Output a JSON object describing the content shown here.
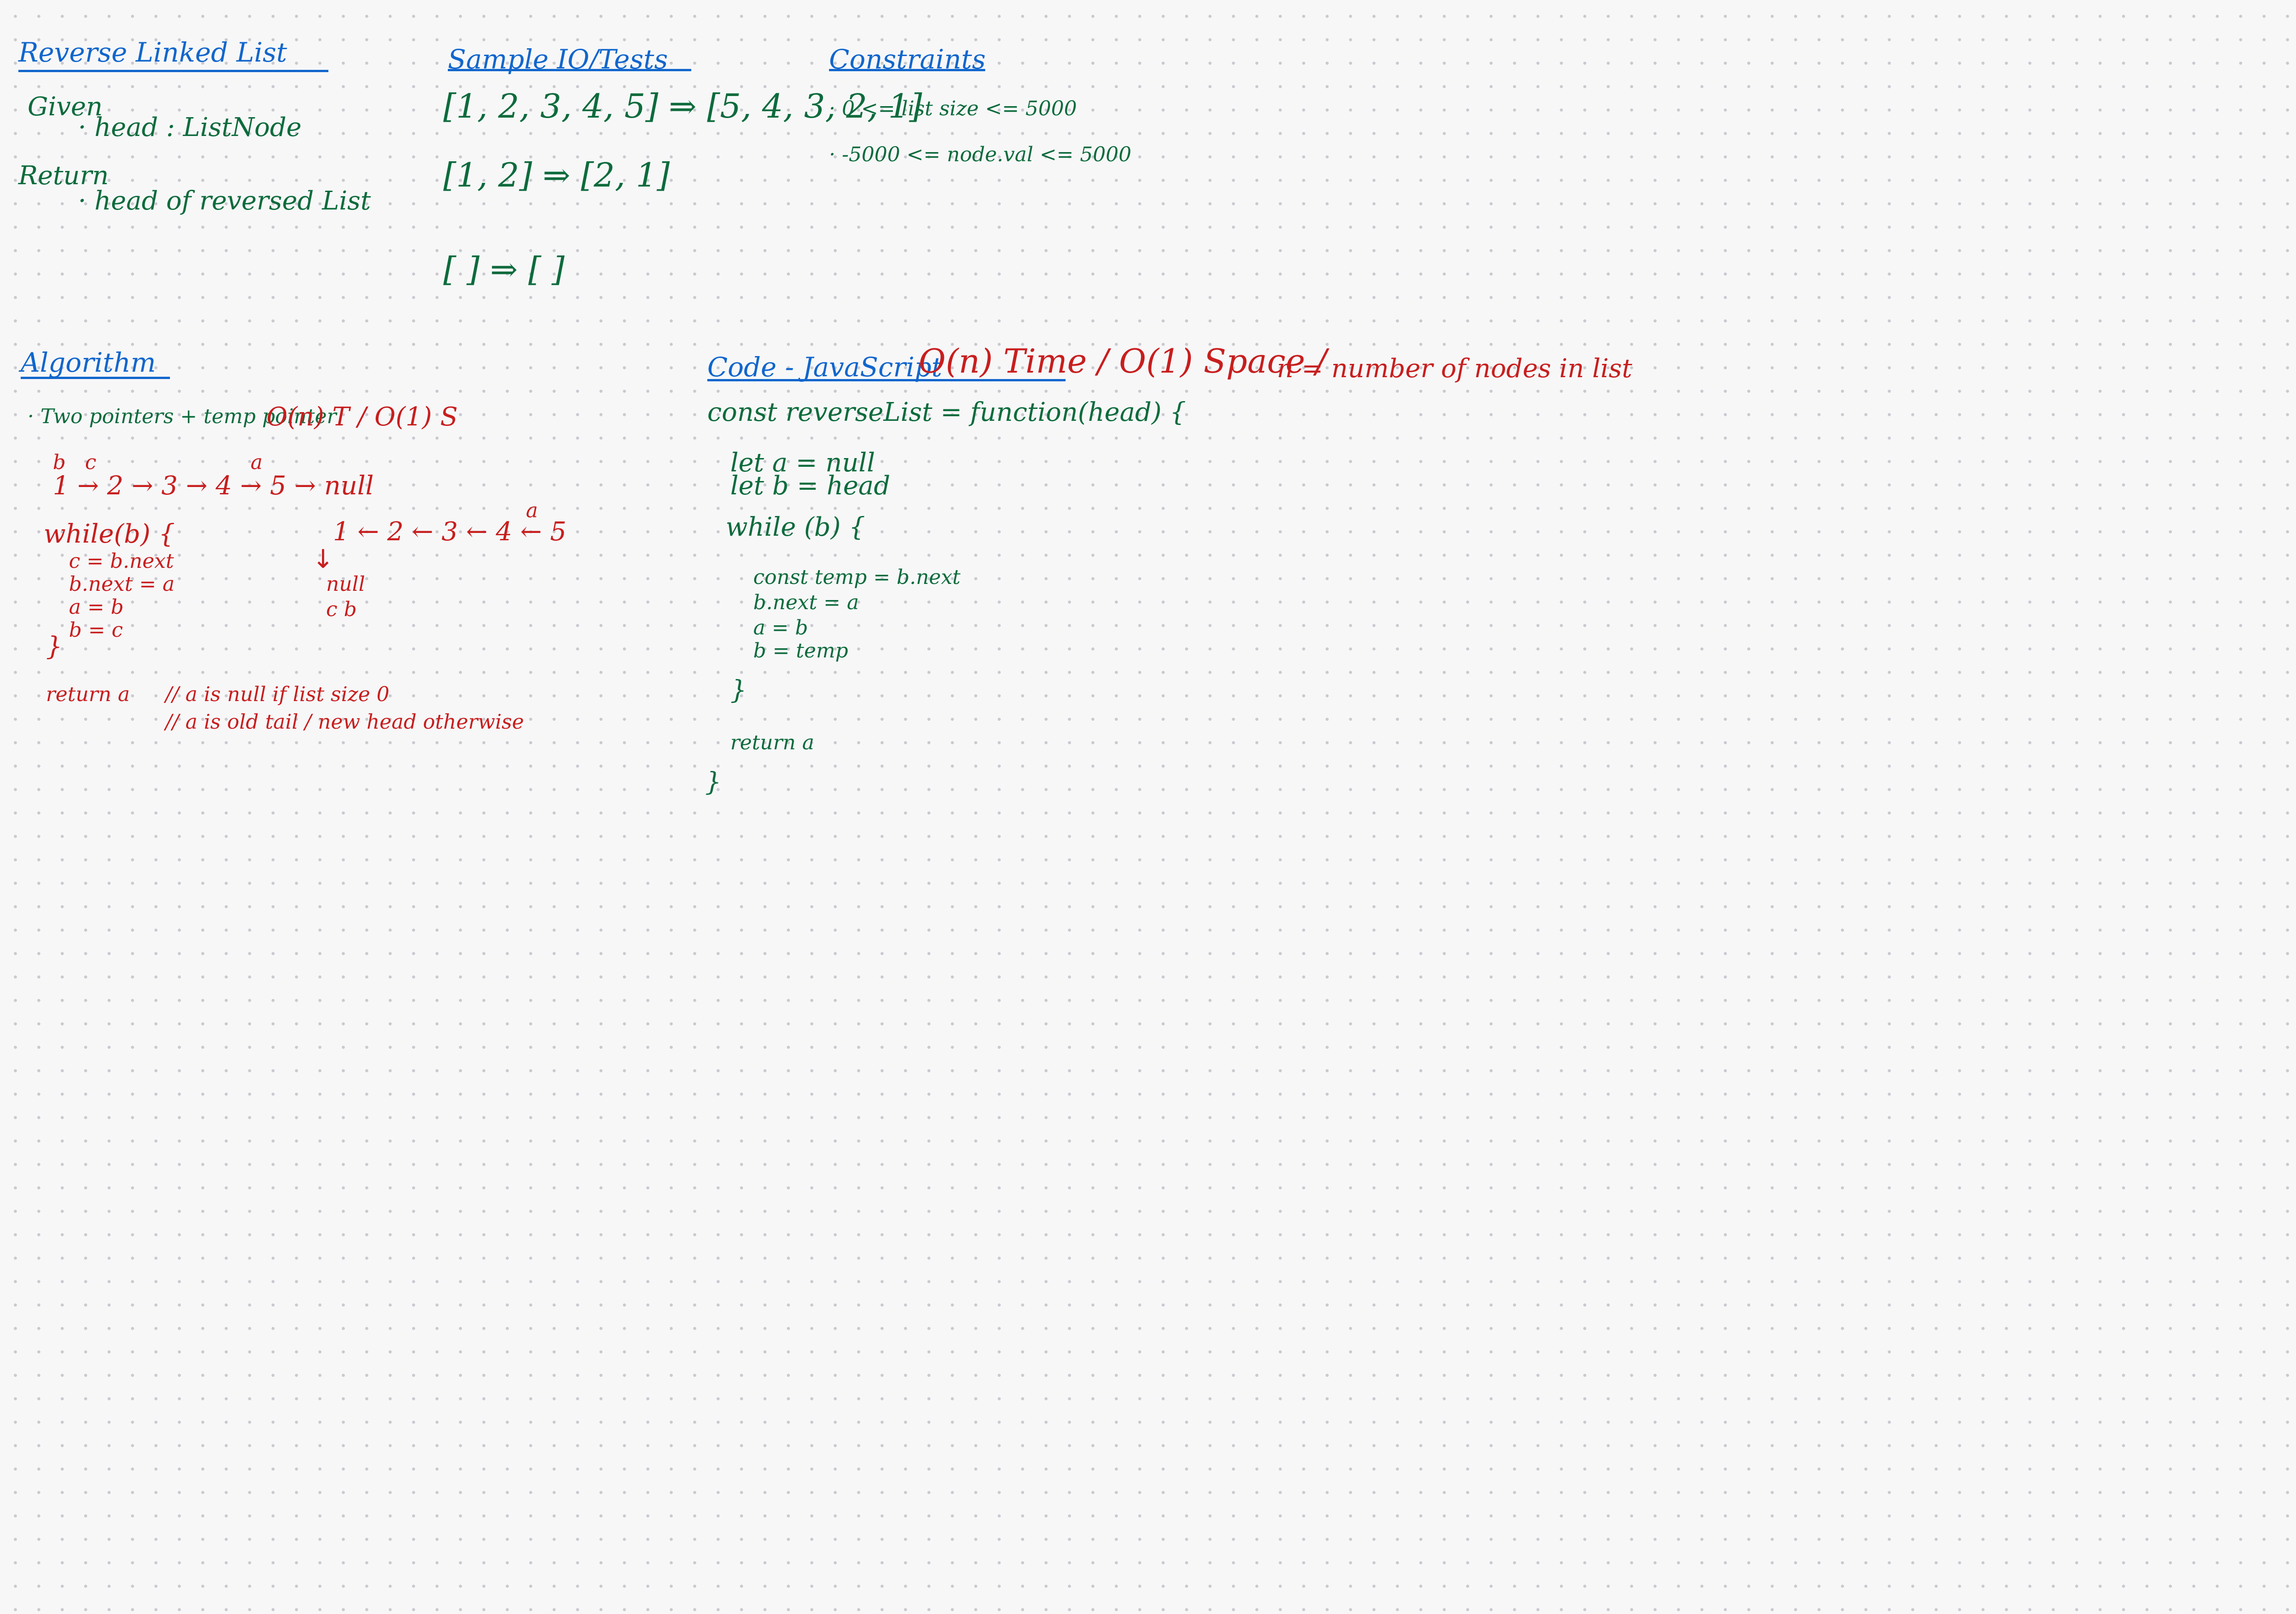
{
  "problem": {
    "title": "Reverse Linked List",
    "given_label": "Given",
    "given_item": "· head : ListNode",
    "return_label": "Return",
    "return_item": "· head of reversed List"
  },
  "samples": {
    "title": "Sample IO/Tests",
    "tests": [
      "[1, 2, 3, 4, 5] ⇒ [5, 4, 3, 2, 1]",
      "[1, 2] ⇒ [2, 1]",
      "[ ] ⇒ [ ]"
    ]
  },
  "constraints": {
    "title": "Constraints",
    "items": [
      "· 0 <= list size <= 5000",
      "· -5000 <= node.val <= 5000"
    ]
  },
  "algorithm": {
    "title": "Algorithm",
    "summary": "· Two pointers + temp pointer",
    "complexity": "O(n) T / O(1) S",
    "labels_top": "b   c                        a",
    "list_forward": "1 → 2 → 3 → 4 → 5 → null",
    "list_reversed": "1 ← 2 ← 3 ← 4 ← 5",
    "label_a": "a",
    "down_arrow": "↓",
    "null_text": "null",
    "cb_text": "c b",
    "while_line": "while(b) {",
    "body": [
      "c = b.next",
      "b.next = a",
      "a = b",
      "b = c"
    ],
    "close": "}",
    "return_line": "return a",
    "comments": [
      "// a is null if list size 0",
      "// a is old tail / new head otherwise"
    ]
  },
  "code": {
    "title": "Code - JavaScript",
    "complexity": "O(n) Time / O(1) Space /",
    "note": "n = number of nodes in list",
    "lines": {
      "l1": "const reverseList = function(head) {",
      "l2": "let a = null",
      "l3": "let b = head",
      "l4": "while (b) {",
      "l5": "const temp = b.next",
      "l6": "b.next = a",
      "l7": "a = b",
      "l8": "b = temp",
      "l9": "}",
      "l10": "return a",
      "l11": "}"
    }
  },
  "colors": {
    "heading": "#1166cc",
    "ink_green": "#0d6b3c",
    "ink_red": "#c81e1e",
    "background": "#f7f7f8"
  }
}
